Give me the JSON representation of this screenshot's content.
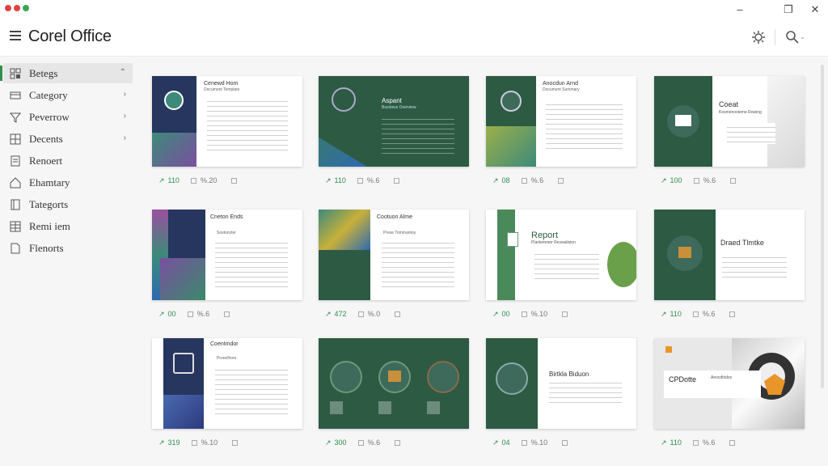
{
  "titlebar": {
    "minimize": "–",
    "maximize": "❐",
    "close": "✕"
  },
  "header": {
    "app_title": "Corel Office"
  },
  "sidebar": {
    "items": [
      {
        "label": "Betegs",
        "icon": "template-icon"
      },
      {
        "label": "Category",
        "icon": "mail-icon"
      },
      {
        "label": "Peverrow",
        "icon": "filter-icon"
      },
      {
        "label": "Decents",
        "icon": "grid-icon"
      },
      {
        "label": "Renoert",
        "icon": "document-icon"
      },
      {
        "label": "Ehamtary",
        "icon": "home-icon"
      },
      {
        "label": "Tategorts",
        "icon": "book-icon"
      },
      {
        "label": "Remi iem",
        "icon": "table-icon"
      },
      {
        "label": "Flenorts",
        "icon": "page-icon"
      }
    ]
  },
  "cards": [
    {
      "title": "Cenewd Hom",
      "sub": "Document Template",
      "meta_a": "110",
      "meta_b": "%.20"
    },
    {
      "title": "Aspant",
      "sub": "Business Overview",
      "meta_a": "110",
      "meta_b": "%.6"
    },
    {
      "title": "Anocdun Arnd",
      "sub": "Document Summary",
      "meta_a": "08",
      "meta_b": "%.6"
    },
    {
      "title": "Coeat",
      "sub": "Kosmonosteme Rowing",
      "meta_a": "100",
      "meta_b": "%.6"
    },
    {
      "title": "Cneton Ends",
      "sub": "Sostoncter",
      "meta_a": "00",
      "meta_b": "%.6"
    },
    {
      "title": "Cootuon Alme",
      "sub": "Prese Tommantoy",
      "meta_a": "472",
      "meta_b": "%.0"
    },
    {
      "title": "Report",
      "sub": "Planlemmer Reswalision",
      "meta_a": "00",
      "meta_b": "%.10"
    },
    {
      "title": "Draed Tlmtke",
      "sub": "",
      "meta_a": "110",
      "meta_b": "%.6"
    },
    {
      "title": "Coentmdor",
      "sub": "Proeelhore",
      "meta_a": "319",
      "meta_b": "%.10"
    },
    {
      "title": "",
      "sub": "",
      "meta_a": "300",
      "meta_b": "%.6"
    },
    {
      "title": "Birtkla Biduon",
      "sub": "",
      "meta_a": "04",
      "meta_b": "%.10"
    },
    {
      "title": "CPDotte",
      "sub": "Anocdhidos",
      "meta_a": "110",
      "meta_b": "%.6"
    }
  ],
  "colors": {
    "accent": "#2f8f4e",
    "dark_green": "#2d5a43",
    "navy": "#26365e"
  }
}
